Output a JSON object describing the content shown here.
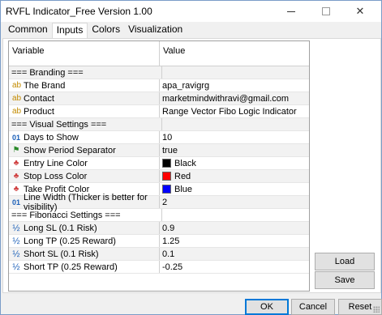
{
  "window": {
    "title": "RVFL Indicator_Free Version 1.00",
    "close_glyph": "✕"
  },
  "tabs": [
    {
      "label": "Common"
    },
    {
      "label": "Inputs"
    },
    {
      "label": "Colors"
    },
    {
      "label": "Visualization"
    }
  ],
  "grid": {
    "header": {
      "variable": "Variable",
      "value": "Value"
    },
    "rows": [
      {
        "type": "group",
        "label": "=== Branding ==="
      },
      {
        "type": "text",
        "icon": "ab",
        "label": "The Brand",
        "value": "apa_ravigrg"
      },
      {
        "type": "text",
        "icon": "ab",
        "label": "Contact",
        "value": "marketmindwithravi@gmail.com"
      },
      {
        "type": "text",
        "icon": "ab",
        "label": "Product",
        "value": "Range Vector Fibo Logic Indicator"
      },
      {
        "type": "group",
        "label": "=== Visual Settings ==="
      },
      {
        "type": "int",
        "icon": "01",
        "label": "Days to Show",
        "value": "10"
      },
      {
        "type": "bool",
        "icon": "flag",
        "label": "Show Period Separator",
        "value": "true"
      },
      {
        "type": "color",
        "icon": "palette",
        "label": "Entry Line Color",
        "value": "Black",
        "swatch": "#000000"
      },
      {
        "type": "color",
        "icon": "palette",
        "label": "Stop Loss Color",
        "value": "Red",
        "swatch": "#ff0000"
      },
      {
        "type": "color",
        "icon": "palette",
        "label": "Take Profit Color",
        "value": "Blue",
        "swatch": "#0000ff"
      },
      {
        "type": "int",
        "icon": "01",
        "label": "Line Width (Thicker is better for visibility)",
        "value": "2"
      },
      {
        "type": "group",
        "label": "=== Fibonacci Settings ==="
      },
      {
        "type": "double",
        "icon": "half",
        "label": "Long SL (0.1 Risk)",
        "value": "0.9"
      },
      {
        "type": "double",
        "icon": "half",
        "label": "Long TP (0.25 Reward)",
        "value": "1.25"
      },
      {
        "type": "double",
        "icon": "half",
        "label": "Short SL (0.1 Risk)",
        "value": "0.1"
      },
      {
        "type": "double",
        "icon": "half",
        "label": "Short TP (0.25 Reward)",
        "value": "-0.25"
      }
    ]
  },
  "side_buttons": {
    "load": "Load",
    "save": "Save"
  },
  "footer": {
    "ok": "OK",
    "cancel": "Cancel",
    "reset": "Reset"
  },
  "colors": {
    "accent": "#0078d7",
    "active_tab": "#ffffff"
  }
}
